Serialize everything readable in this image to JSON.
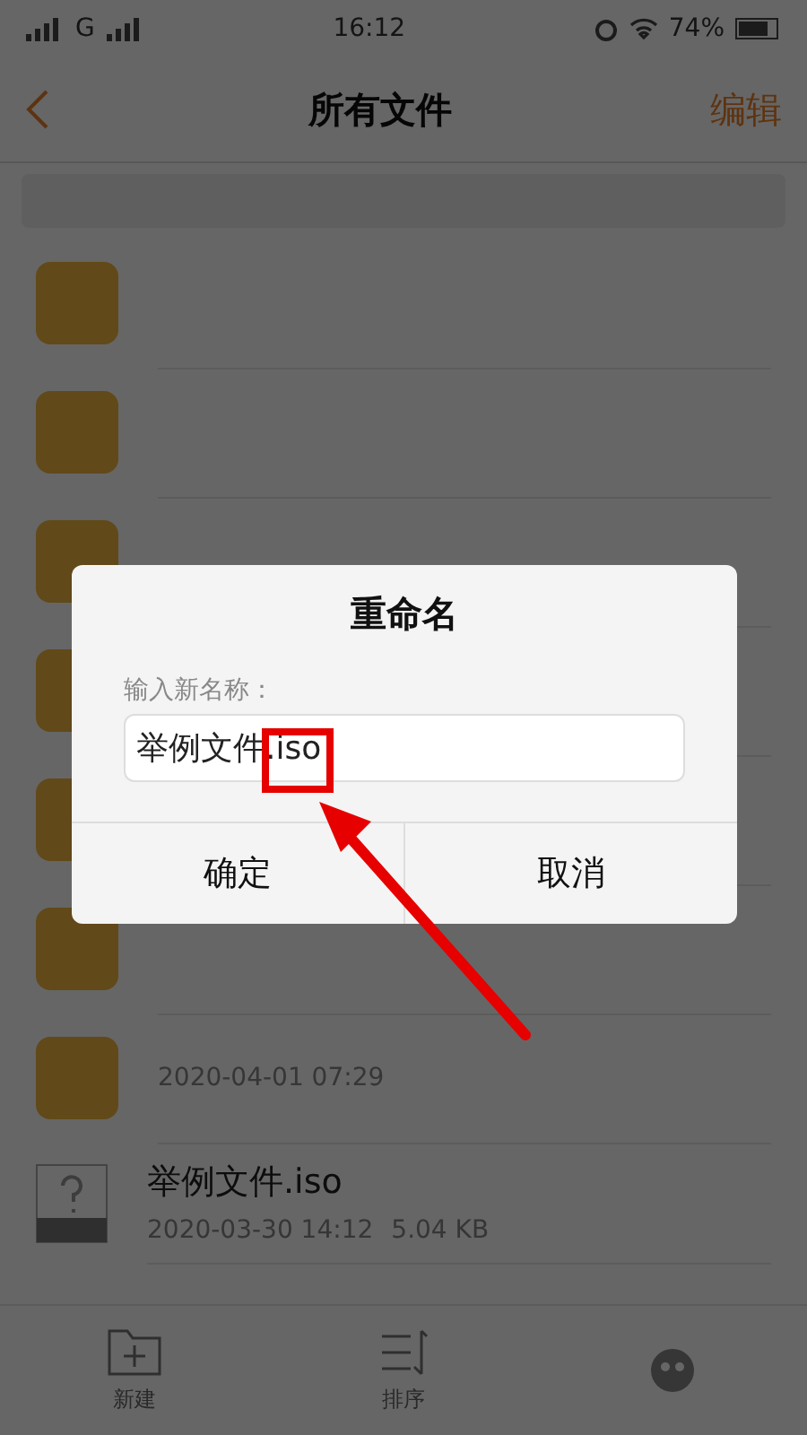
{
  "status_bar": {
    "carrier": "G",
    "time": "16:12",
    "battery": "74%"
  },
  "header": {
    "title": "所有文件",
    "action": "编辑"
  },
  "files": [
    {
      "kind": "folder"
    },
    {
      "kind": "folder"
    },
    {
      "kind": "folder"
    },
    {
      "kind": "folder"
    },
    {
      "kind": "folder"
    },
    {
      "kind": "folder"
    },
    {
      "kind": "folder",
      "date": "2020-04-01 07:29"
    },
    {
      "kind": "file",
      "name": "举例文件.iso",
      "date": "2020-03-30 14:12",
      "size": "5.04 KB"
    }
  ],
  "dialog": {
    "title": "重命名",
    "label": "输入新名称：",
    "value": "举例文件.iso",
    "buttons": [
      "确定",
      "取消"
    ]
  },
  "toolbar": [
    {
      "kind": "new",
      "label": "新建"
    },
    {
      "kind": "sort",
      "label": "排序"
    },
    {
      "kind": "more"
    }
  ]
}
